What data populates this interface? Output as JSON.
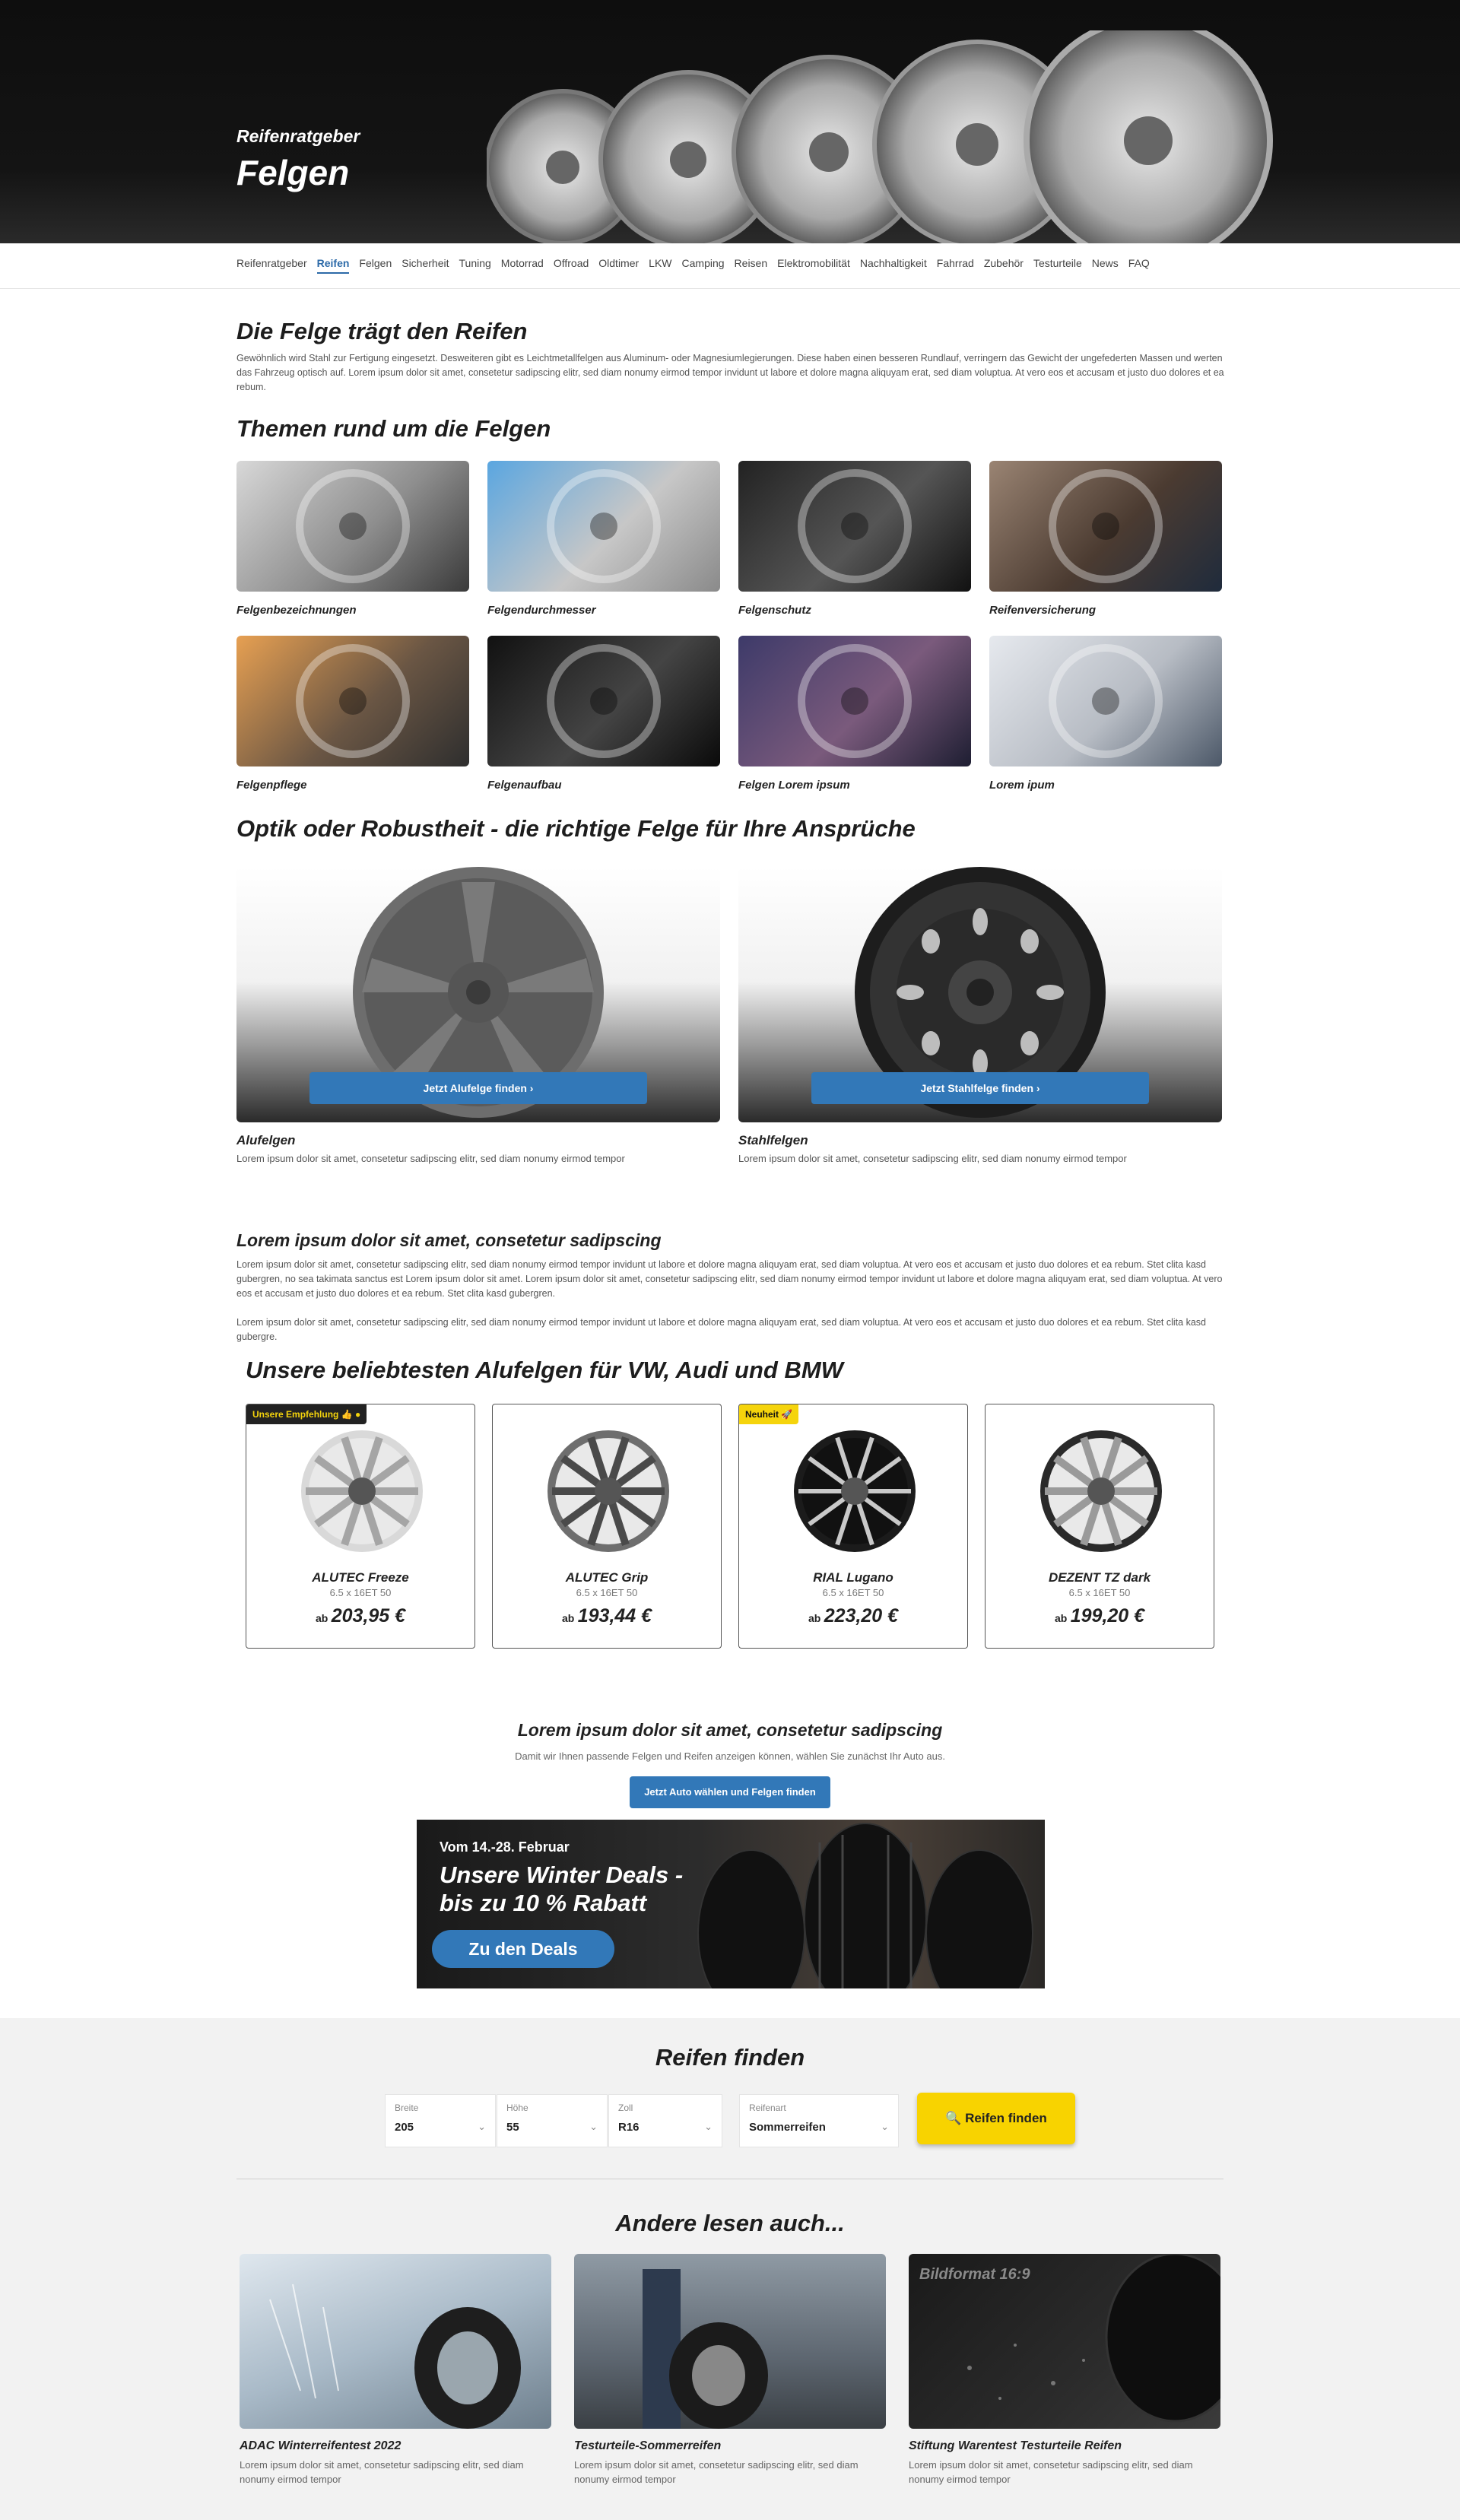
{
  "hero": {
    "kicker": "Reifenratgeber",
    "title": "Felgen"
  },
  "nav": [
    "Reifenratgeber",
    "Reifen",
    "Felgen",
    "Sicherheit",
    "Tuning",
    "Motorrad",
    "Offroad",
    "Oldtimer",
    "LKW",
    "Camping",
    "Reisen",
    "Elektromobilität",
    "Nachhaltigkeit",
    "Fahrrad",
    "Zubehör",
    "Testurteile",
    "News",
    "FAQ"
  ],
  "nav_active": "Reifen",
  "intro": {
    "title": "Die Felge trägt den Reifen",
    "text": "Gewöhnlich wird Stahl zur Fertigung eingesetzt. Desweiteren gibt es Leichtmetallfelgen aus Aluminum- oder Magnesiumlegierungen. Diese haben einen besseren Rundlauf, verringern das Gewicht der ungefederten Massen und werten das Fahrzeug optisch auf. Lorem ipsum dolor sit amet, consetetur sadipscing elitr, sed diam nonumy eirmod tempor invidunt ut labore et dolore magna aliquyam erat, sed diam voluptua. At vero eos et accusam et justo duo dolores et ea rebum."
  },
  "topics": {
    "title": "Themen rund um die Felgen",
    "items": [
      "Felgenbezeichnungen",
      "Felgendurchmesser",
      "Felgenschutz",
      "Reifenversicherung",
      "Felgenpflege",
      "Felgenaufbau",
      "Felgen Lorem ipsum",
      "Lorem ipum"
    ]
  },
  "choice": {
    "title": "Optik oder Robustheit - die richtige Felge für Ihre Ansprüche",
    "cards": [
      {
        "button": "Jetzt Alufelge finden  ›",
        "title": "Alufelgen",
        "text": "Lorem ipsum dolor sit amet, consetetur sadipscing elitr, sed diam nonumy eirmod tempor"
      },
      {
        "button": "Jetzt Stahlfelge finden  ›",
        "title": "Stahlfelgen",
        "text": "Lorem ipsum dolor sit amet, consetetur sadipscing elitr, sed diam nonumy eirmod tempor"
      }
    ]
  },
  "lorem": {
    "title": "Lorem ipsum dolor sit amet, consetetur sadipscing",
    "p1": "Lorem ipsum dolor sit amet, consetetur sadipscing elitr, sed diam nonumy eirmod tempor invidunt ut labore et dolore magna aliquyam erat, sed diam voluptua. At vero eos et accusam et justo duo dolores et ea rebum. Stet clita kasd gubergren, no sea takimata sanctus est Lorem ipsum dolor sit amet. Lorem ipsum dolor sit amet, consetetur sadipscing elitr, sed diam nonumy eirmod tempor invidunt ut labore et dolore magna aliquyam erat, sed diam voluptua. At vero eos et accusam et justo duo dolores et ea rebum. Stet clita kasd gubergren.",
    "p2": "Lorem ipsum dolor sit amet, consetetur sadipscing elitr, sed diam nonumy eirmod tempor invidunt ut labore et dolore magna aliquyam erat, sed diam voluptua. At vero eos et accusam et justo duo dolores et ea rebum. Stet clita kasd gubergre."
  },
  "products": {
    "title": "Unsere beliebtesten Alufelgen für VW, Audi und BMW",
    "items": [
      {
        "badge": "Unsere Empfehlung 👍 ●",
        "name": "ALUTEC Freeze",
        "size": "6.5 x 16ET 50",
        "ab": "ab",
        "price": "203,95 €"
      },
      {
        "badge": "",
        "name": "ALUTEC Grip",
        "size": "6.5 x 16ET 50",
        "ab": "ab",
        "price": "193,44 €"
      },
      {
        "badge": "Neuheit 🚀",
        "name": "RIAL Lugano",
        "size": "6.5 x 16ET 50",
        "ab": "ab",
        "price": "223,20 €"
      },
      {
        "badge": "",
        "name": "DEZENT TZ dark",
        "size": "6.5 x 16ET 50",
        "ab": "ab",
        "price": "199,20 €"
      }
    ]
  },
  "cta": {
    "title": "Lorem ipsum dolor sit amet, consetetur sadipscing",
    "sub": "Damit wir Ihnen passende Felgen und Reifen anzeigen können, wählen Sie zunächst Ihr Auto aus.",
    "button": "Jetzt Auto wählen und Felgen finden"
  },
  "banner": {
    "dates": "Vom 14.-28. Februar",
    "line1": "Unsere Winter Deals -",
    "line2": "bis zu 10 % Rabatt",
    "button": "Zu den Deals"
  },
  "finder": {
    "title": "Reifen finden",
    "fields": [
      {
        "label": "Breite",
        "value": "205"
      },
      {
        "label": "Höhe",
        "value": "55"
      },
      {
        "label": "Zoll",
        "value": "R16"
      },
      {
        "label": "Reifenart",
        "value": "Sommerreifen"
      }
    ],
    "button": "🔍 Reifen finden"
  },
  "related": {
    "title": "Andere lesen auch...",
    "items": [
      {
        "title": "ADAC Winterreifentest 2022",
        "text": "Lorem ipsum dolor sit amet, consetetur sadipscing elitr, sed diam nonumy eirmod tempor"
      },
      {
        "title": "Testurteile-Sommerreifen",
        "text": "Lorem ipsum dolor sit amet, consetetur sadipscing elitr, sed diam nonumy eirmod tempor"
      },
      {
        "title": "Stiftung Warentest Testurteile Reifen",
        "text": "Lorem ipsum dolor sit amet, consetetur sadipscing elitr, sed diam nonumy eirmod tempor",
        "overlay": "Bildformat 16:9"
      }
    ]
  },
  "colors": {
    "accent": "#3278b8",
    "yellow": "#f8d300",
    "hero_bg": "#111111"
  }
}
